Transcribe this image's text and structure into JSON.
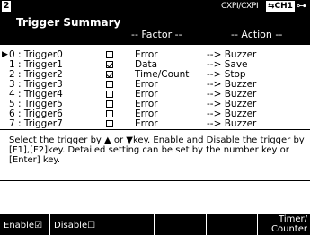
{
  "status_bar": {
    "page_number": "2",
    "channel_mode": "CXPI/CXPI",
    "channel": "CH1",
    "connection_icon": "plug-icon"
  },
  "header": {
    "title": "Trigger Summary",
    "factor_col": "-- Factor --",
    "action_col": "-- Action --"
  },
  "triggers": [
    {
      "name": "0 : Trigger0",
      "enabled": false,
      "selected": true,
      "factor": "Error",
      "action": "--> Buzzer"
    },
    {
      "name": "1 : Trigger1",
      "enabled": true,
      "selected": false,
      "factor": "Data",
      "action": "--> Save"
    },
    {
      "name": "2 : Trigger2",
      "enabled": true,
      "selected": false,
      "factor": "Time/Count",
      "action": "--> Stop"
    },
    {
      "name": "3 : Trigger3",
      "enabled": false,
      "selected": false,
      "factor": "Error",
      "action": "--> Buzzer"
    },
    {
      "name": "4 : Trigger4",
      "enabled": false,
      "selected": false,
      "factor": "Error",
      "action": "--> Buzzer"
    },
    {
      "name": "5 : Trigger5",
      "enabled": false,
      "selected": false,
      "factor": "Error",
      "action": "--> Buzzer"
    },
    {
      "name": "6 : Trigger6",
      "enabled": false,
      "selected": false,
      "factor": "Error",
      "action": "--> Buzzer"
    },
    {
      "name": "7 : Trigger7",
      "enabled": false,
      "selected": false,
      "factor": "Error",
      "action": "--> Buzzer"
    }
  ],
  "help_text": "Select the trigger by ▲ or ▼key. Enable and Disable the trigger by [F1],[F2]key. Detailed setting can be set by the number key or [Enter] key.",
  "function_keys": {
    "f1": "Enable☑",
    "f2": "Disable☐",
    "f3": "",
    "f4": "",
    "f5": "",
    "f6_line1": "Timer/",
    "f6_line2": "Counter"
  }
}
